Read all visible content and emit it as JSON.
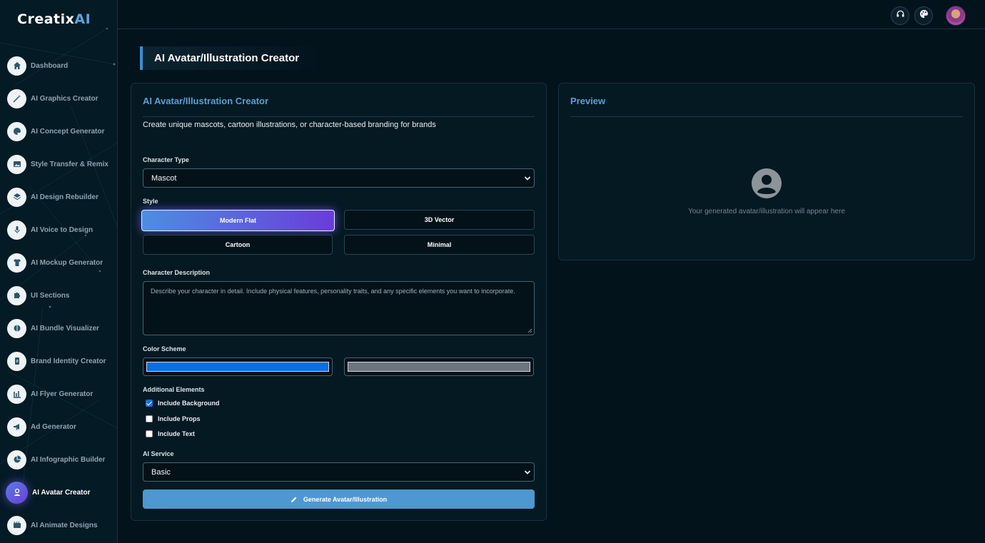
{
  "brand": {
    "name_main": "Creatix",
    "name_accent": "AI"
  },
  "sidebar": {
    "items": [
      {
        "label": "Dashboard",
        "icon": "home-icon"
      },
      {
        "label": "AI Graphics Creator",
        "icon": "magic-wand-icon"
      },
      {
        "label": "AI Concept Generator",
        "icon": "palette-icon"
      },
      {
        "label": "Style Transfer & Remix",
        "icon": "image-icon"
      },
      {
        "label": "AI Design Rebuilder",
        "icon": "layers-icon"
      },
      {
        "label": "AI Voice to Design",
        "icon": "microphone-icon"
      },
      {
        "label": "AI Mockup Generator",
        "icon": "tshirt-icon"
      },
      {
        "label": "UI Sections",
        "icon": "puzzle-icon"
      },
      {
        "label": "AI Bundle Visualizer",
        "icon": "cube-icon"
      },
      {
        "label": "Brand Identity Creator",
        "icon": "id-card-icon"
      },
      {
        "label": "AI Flyer Generator",
        "icon": "flyer-icon"
      },
      {
        "label": "Ad Generator",
        "icon": "megaphone-icon"
      },
      {
        "label": "AI Infographic Builder",
        "icon": "pie-chart-icon"
      },
      {
        "label": "AI Avatar Creator",
        "icon": "user-badge-icon",
        "active": true
      },
      {
        "label": "AI Animate Designs",
        "icon": "film-icon"
      }
    ]
  },
  "topbar": {
    "icons": [
      "headset-icon",
      "palette-icon",
      "user-avatar"
    ]
  },
  "page": {
    "title": "AI Avatar/Illustration Creator"
  },
  "form": {
    "title": "AI Avatar/Illustration Creator",
    "subtitle": "Create unique mascots, cartoon illustrations, or character-based branding for brands",
    "character_type": {
      "label": "Character Type",
      "value": "Mascot"
    },
    "style": {
      "label": "Style",
      "options": [
        "Modern Flat",
        "3D Vector",
        "Cartoon",
        "Minimal"
      ],
      "selected": "Modern Flat"
    },
    "description": {
      "label": "Character Description",
      "placeholder": "Describe your character in detail. Include physical features, personality traits, and any specific elements you want to incorporate."
    },
    "color_scheme": {
      "label": "Color Scheme",
      "primary": "#0a6fe0",
      "secondary": "#6c757d"
    },
    "additional": {
      "label": "Additional Elements",
      "options": [
        {
          "label": "Include Background",
          "checked": true
        },
        {
          "label": "Include Props",
          "checked": false
        },
        {
          "label": "Include Text",
          "checked": false
        }
      ]
    },
    "ai_service": {
      "label": "AI Service",
      "value": "Basic"
    },
    "generate_label": "Generate Avatar/Illustration"
  },
  "preview": {
    "title": "Preview",
    "placeholder": "Your generated avatar/illustration will appear here"
  },
  "colors": {
    "accent": "#5c9fd6",
    "button": "#4f97d1",
    "background": "#03131c",
    "gradient_start": "#4c8fe0",
    "gradient_end": "#6a3cd9"
  }
}
